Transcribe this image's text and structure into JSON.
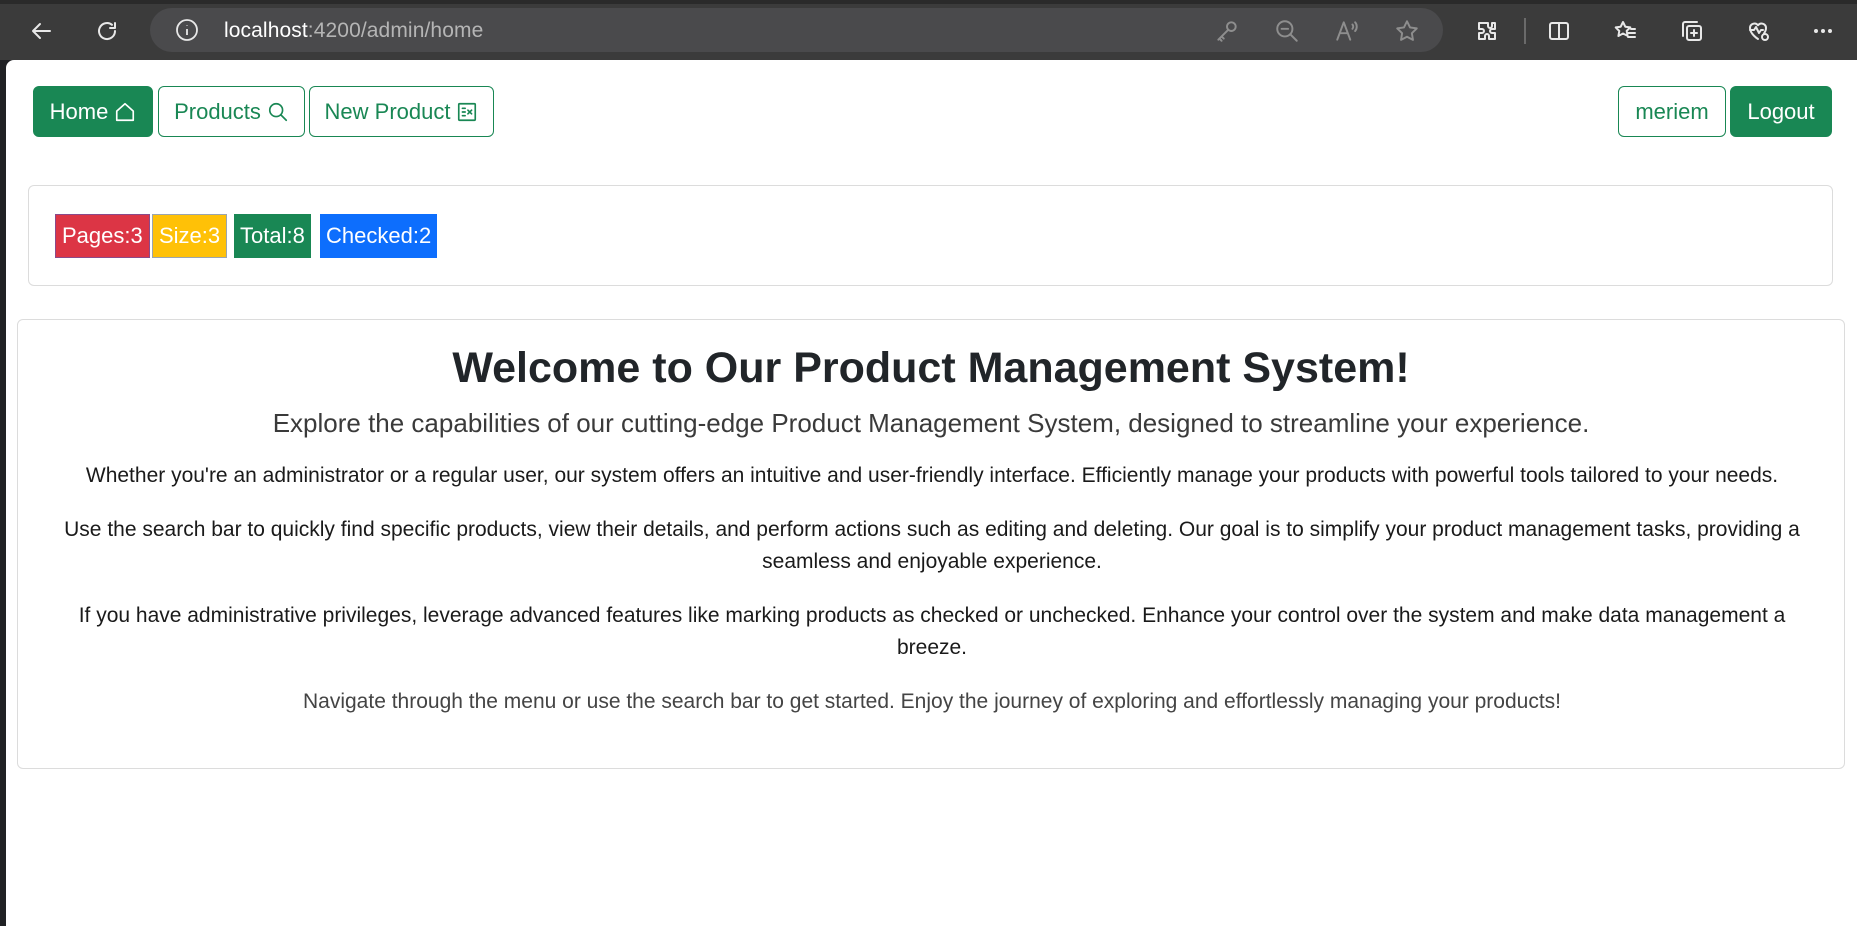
{
  "browser": {
    "url_host": "localhost",
    "url_path": ":4200/admin/home"
  },
  "nav": {
    "home_label": "Home",
    "products_label": "Products",
    "new_product_label": "New Product",
    "user_label": "meriem",
    "logout_label": "Logout"
  },
  "stats": {
    "pages": "Pages:3",
    "size": "Size:3",
    "total": "Total:8",
    "checked": "Checked:2"
  },
  "welcome": {
    "title": "Welcome to Our Product Management System!",
    "lead": "Explore the capabilities of our cutting-edge Product Management System, designed to streamline your experience.",
    "p1": "Whether you're an administrator or a regular user, our system offers an intuitive and user-friendly interface. Efficiently manage your products with powerful tools tailored to your needs.",
    "p2": "Use the search bar to quickly find specific products, view their details, and perform actions such as editing and deleting. Our goal is to simplify your product management tasks, providing a seamless and enjoyable experience.",
    "p3": "If you have administrative privileges, leverage advanced features like marking products as checked or unchecked. Enhance your control over the system and make data management a breeze.",
    "p4": "Navigate through the menu or use the search bar to get started. Enjoy the journey of exploring and effortlessly managing your products!"
  },
  "colors": {
    "success": "#198754",
    "danger": "#dc3545",
    "warning": "#ffc107",
    "primary": "#0d6efd"
  }
}
